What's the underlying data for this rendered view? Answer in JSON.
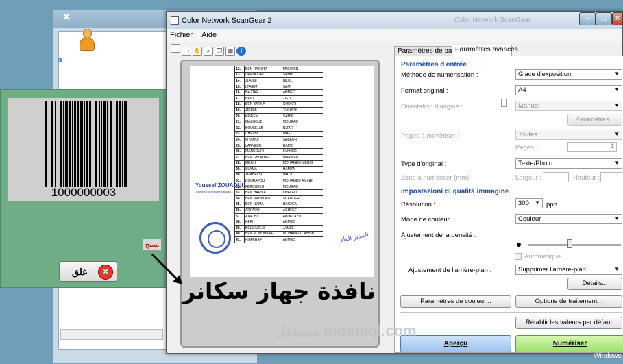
{
  "bg_window": {
    "close_glyph": "✕",
    "letter": "a"
  },
  "barcode_window": {
    "number": "1000000003",
    "scan_button": "مسح",
    "close_button": "غلق",
    "close_glyph": "✕"
  },
  "caption": "نافذة جهاز سكانر",
  "scangear": {
    "title": "Color Network ScanGear 2",
    "ghost_title": "Color Network ScanGear",
    "menu": [
      "Fichier",
      "Aide"
    ],
    "document_rows": [
      [
        "12.",
        "BEN RAOUTA",
        "MARWEN"
      ],
      [
        "13.",
        "DARDOURI",
        "SAHBI"
      ],
      [
        "14.",
        "JLASSI",
        "BILEL"
      ],
      [
        "15.",
        "LTAIEM",
        "SAMI"
      ],
      [
        "16.",
        "NAJJAR",
        "AHMED"
      ],
      [
        "17.",
        "NEILI",
        "ZIED"
      ],
      [
        "18.",
        "BEN BARKA",
        "CHOKRI"
      ],
      [
        "19.",
        "JDIDMI",
        "TAOUFIK"
      ],
      [
        "20.",
        "KRAIEM",
        "SAMIR"
      ],
      [
        "21.",
        "MAZHOUD",
        "MOURAD"
      ],
      [
        "22.",
        "BOUSELMI",
        "NIZAR"
      ],
      [
        "23.",
        "CHELBI",
        "WAEL"
      ],
      [
        "24.",
        "MYAMDI",
        "SABEUR"
      ],
      [
        "25.",
        "LARYEDH",
        "RAMZI"
      ],
      [
        "26.",
        "MANSOURI",
        "FAKHER"
      ],
      [
        "27.",
        "BEN GHORBEL",
        "MARWEN"
      ],
      [
        "28.",
        "MELKI",
        "MOHAMED MEHDI"
      ],
      [
        "29.",
        "SLAMA",
        "HAMZA"
      ],
      [
        "30.",
        "TRABELSI",
        "WALID"
      ],
      [
        "31.",
        "BOURAFOU",
        "MOHAMED AMINE"
      ],
      [
        "32.",
        "FERCHICHI",
        "MOURAD"
      ],
      [
        "33.",
        "BEN HAFSIA",
        "KHALED"
      ],
      [
        "34.",
        "BEN MABROUK",
        "SKANDER"
      ],
      [
        "35.",
        "BEN NJIMA",
        "HACHEM"
      ],
      [
        "36.",
        "ARFAOUI",
        "ACHREF"
      ],
      [
        "37.",
        "AYACHI",
        "ABDELAZIZ"
      ],
      [
        "38.",
        "KEFI",
        "AHMED"
      ],
      [
        "39.",
        "BELGACEM",
        "JAMEL"
      ],
      [
        "40.",
        "BEN ROMDHANE",
        "MOHAMED LAHBIB"
      ],
      [
        "41.",
        "KHARRAF",
        "AHMED"
      ]
    ],
    "signature_name": "Youssef ZOUAOUI",
    "signature_sub": "Directeur Technique National",
    "signature_right": "المدير العام",
    "tabs": {
      "basic": "Paramètres de base",
      "advanced": "Paramètres avancés"
    },
    "input_section": "Paramètres d'entrée",
    "method_label": "Méthode de numérisation :",
    "method_value": "Glace d'exposition",
    "format_label": "Format original :",
    "format_value": "A4",
    "orientation_label": "Orientation d'origine :",
    "orientation_value": "Manuel",
    "params_button": "Paramètres...",
    "pages_label": "Pages à numériser :",
    "pages_value": "Toutes",
    "pages_field_label": "Pages :",
    "pages_field_value": "1",
    "type_label": "Type d'original :",
    "type_value": "Texte/Photo",
    "zone_label": "Zone à numériser (mm)",
    "width_label": "Largeur :",
    "height_label": "Hauteur :",
    "quality_section": "Impostazioni di qualità immagine",
    "resolution_label": "Résolution :",
    "resolution_value": "300",
    "resolution_unit": "ppp",
    "color_mode_label": "Mode de couleur :",
    "color_mode_value": "Couleur",
    "density_label": "Ajustement de la densité :",
    "auto_label": "Automatique",
    "background_label": "Ajustement de l'arrière-plan :",
    "background_value": "Supprimer l'arrière-plan",
    "details_button": "Détails...",
    "color_params_button": "Paramètres de couleur...",
    "processing_button": "Options de traitement...",
    "reset_button": "Rétablir les valeurs par défaut",
    "preview_button": "Aperçu",
    "scan_button": "Numériser"
  },
  "watermark": "مستقل mostaql.com",
  "taskbar_label": "Windows"
}
